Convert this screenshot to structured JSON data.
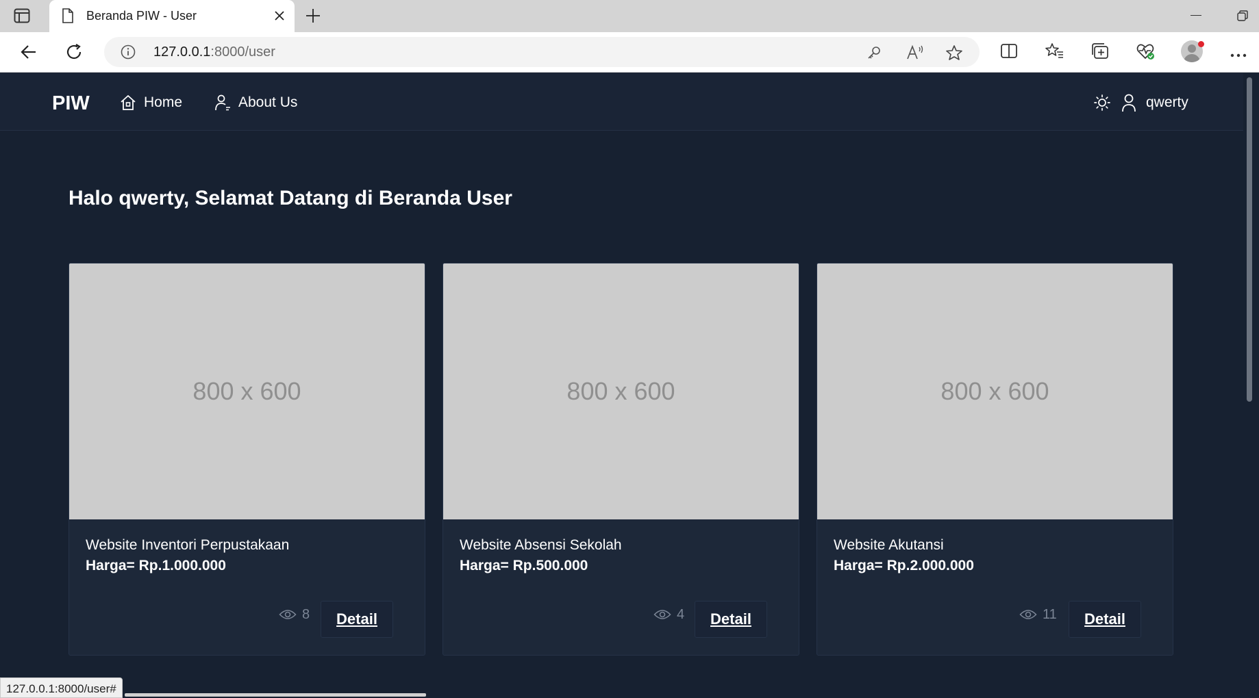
{
  "browser": {
    "tab_title": "Beranda PIW - User",
    "url_host": "127.0.0.1",
    "url_rest": ":8000/user",
    "status_url": "127.0.0.1:8000/user#"
  },
  "navbar": {
    "brand": "PIW",
    "home_label": "Home",
    "about_label": "About Us",
    "username": "qwerty"
  },
  "main": {
    "greeting": "Halo qwerty, Selamat Datang di Beranda User",
    "cards": [
      {
        "image_text": "800 x 600",
        "title": "Website Inventori Perpustakaan",
        "price": "Harga= Rp.1.000.000",
        "views": "8",
        "button": "Detail"
      },
      {
        "image_text": "800 x 600",
        "title": "Website Absensi Sekolah",
        "price": "Harga= Rp.500.000",
        "views": "4",
        "button": "Detail"
      },
      {
        "image_text": "800 x 600",
        "title": "Website Akutansi",
        "price": "Harga= Rp.2.000.000",
        "views": "11",
        "button": "Detail"
      }
    ]
  },
  "icons": {
    "tab": "document-icon",
    "nav_home": "home-icon",
    "nav_about": "users-icon",
    "theme": "sun-icon",
    "user": "user-icon",
    "views": "eye-icon"
  },
  "colors": {
    "page_bg": "#172131",
    "navbar_bg": "#1a2436",
    "card_bg": "#1d2839",
    "placeholder": "#cccccc"
  }
}
